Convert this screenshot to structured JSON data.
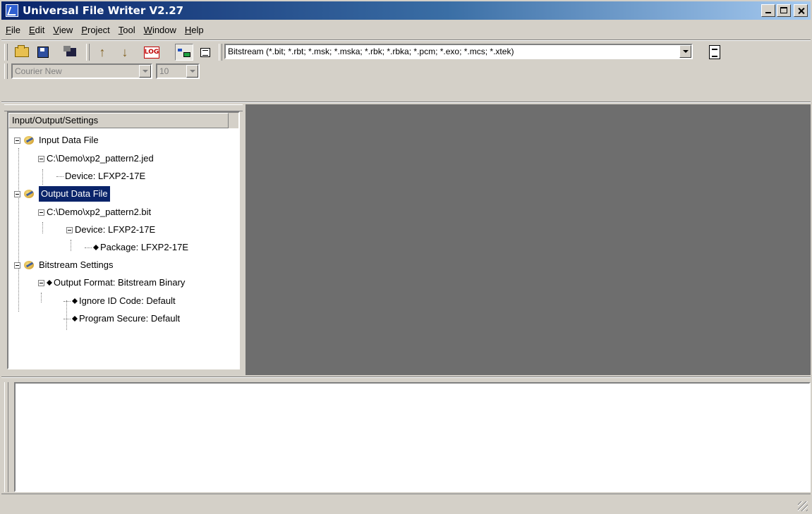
{
  "window": {
    "title": "Universal File Writer V2.27"
  },
  "menu": [
    "File",
    "Edit",
    "View",
    "Project",
    "Tool",
    "Window",
    "Help"
  ],
  "toolbar": {
    "log_label": "LOG",
    "filetype_value": "Bitstream (*.bit; *.rbt; *.msk; *.mska; *.rbk; *.rbka; *.pcm; *.exo; *.mcs; *.xtek)",
    "font_name": "Courier New",
    "font_size": "10"
  },
  "tree": {
    "header": "Input/Output/Settings",
    "input_data_file": "Input Data File",
    "input_path": "C:\\Demo\\xp2_pattern2.jed",
    "input_device": "Device: LFXP2-17E",
    "output_data_file": "Output Data File",
    "output_path": "C:\\Demo\\xp2_pattern2.bit",
    "output_device": "Device: LFXP2-17E",
    "output_package": "Package: LFXP2-17E",
    "bitstream_settings": "Bitstream  Settings",
    "output_format": "Output Format: Bitstream Binary",
    "ignore_id": "Ignore ID Code: Default",
    "program_secure": "Program Secure: Default"
  }
}
